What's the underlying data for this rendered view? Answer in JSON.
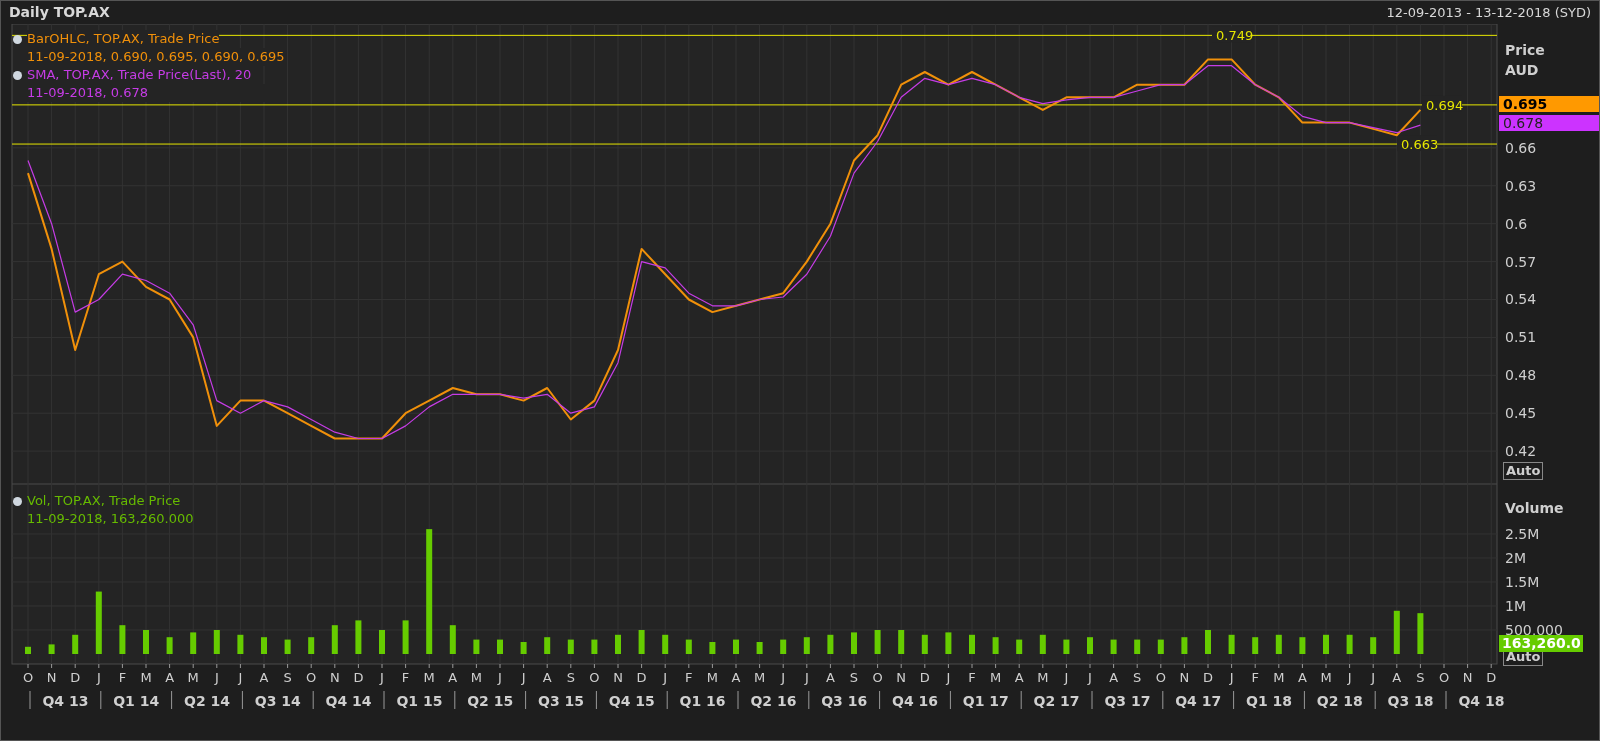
{
  "header": {
    "title": "Daily TOP.AX",
    "date_range": "12-09-2013 - 13-12-2018 (SYD)"
  },
  "price_panel": {
    "axis_title": "Price",
    "axis_unit": "AUD",
    "auto_button": "Auto",
    "legend": [
      {
        "title": "BarOHLC, TOP.AX, Trade Price",
        "reading": "11-09-2018, 0.690, 0.695, 0.690, 0.695",
        "color": "#f0900a"
      },
      {
        "title": "SMA, TOP.AX, Trade Price(Last),  20",
        "reading": "11-09-2018, 0.678",
        "color": "#c63ce6"
      }
    ],
    "badges": [
      {
        "label": "0.695",
        "color": "#ff9900"
      },
      {
        "label": "0.678",
        "color": "#cc33ff"
      }
    ],
    "chart_data": {
      "type": "line",
      "grid": true,
      "series": [
        {
          "color": "#f0900a",
          "values": [
            0.64,
            0.58,
            0.5,
            0.56,
            0.57,
            0.55,
            0.54,
            0.51,
            0.44,
            0.46,
            0.46,
            0.45,
            0.44,
            0.43,
            0.43,
            0.43,
            0.45,
            0.46,
            0.47,
            0.465,
            0.465,
            0.46,
            0.47,
            0.445,
            0.46,
            0.5,
            0.58,
            0.56,
            0.54,
            0.53,
            0.535,
            0.54,
            0.545,
            0.57,
            0.6,
            0.65,
            0.67,
            0.71,
            0.72,
            0.71,
            0.72,
            0.71,
            0.7,
            0.69,
            0.7,
            0.7,
            0.7,
            0.71,
            0.71,
            0.71,
            0.73,
            0.73,
            0.71,
            0.7,
            0.68,
            0.68,
            0.68,
            0.675,
            0.67,
            0.69,
            null,
            null,
            null
          ]
        },
        {
          "color": "#c63ce6",
          "values": [
            0.65,
            0.6,
            0.53,
            0.54,
            0.56,
            0.555,
            0.545,
            0.52,
            0.46,
            0.45,
            0.46,
            0.455,
            0.445,
            0.435,
            0.43,
            0.43,
            0.44,
            0.455,
            0.465,
            0.465,
            0.465,
            0.462,
            0.465,
            0.45,
            0.455,
            0.49,
            0.57,
            0.565,
            0.545,
            0.535,
            0.535,
            0.54,
            0.542,
            0.56,
            0.59,
            0.64,
            0.665,
            0.7,
            0.715,
            0.71,
            0.715,
            0.71,
            0.7,
            0.695,
            0.698,
            0.7,
            0.7,
            0.705,
            0.71,
            0.71,
            0.725,
            0.725,
            0.71,
            0.7,
            0.685,
            0.68,
            0.68,
            0.676,
            0.672,
            0.678,
            null,
            null,
            null
          ]
        }
      ],
      "ylim": [
        0.394,
        0.758
      ],
      "yticks": [
        0.42,
        0.45,
        0.48,
        0.51,
        0.54,
        0.57,
        0.6,
        0.63,
        0.66
      ],
      "ref_lines": [
        {
          "axis": "y",
          "value": 0.749,
          "label": "0.749"
        },
        {
          "axis": "y",
          "value": 0.694,
          "label": "0.694"
        },
        {
          "axis": "y",
          "value": 0.663,
          "label": "0.663"
        }
      ]
    }
  },
  "volume_panel": {
    "axis_title": "Volume",
    "auto_button": "Auto",
    "legend": {
      "title": "Vol, TOP.AX, Trade Price",
      "reading": "11-09-2018, 163,260.000",
      "color": "#66bb00"
    },
    "badge": {
      "label": "163,260.0",
      "color": "#66cc00"
    },
    "chart_data": {
      "type": "bar",
      "grid": true,
      "categories": [
        "O",
        "N",
        "D",
        "J",
        "F",
        "M",
        "A",
        "M",
        "J",
        "J",
        "A",
        "S",
        "O",
        "N",
        "D",
        "J",
        "F",
        "M",
        "A",
        "M",
        "J",
        "J",
        "A",
        "S",
        "O",
        "N",
        "D",
        "J",
        "F",
        "M",
        "A",
        "M",
        "J",
        "J",
        "A",
        "S",
        "O",
        "N",
        "D",
        "J",
        "F",
        "M",
        "A",
        "M",
        "J",
        "J",
        "A",
        "S",
        "O",
        "N",
        "D",
        "J",
        "F",
        "M",
        "A",
        "M",
        "J",
        "J",
        "A",
        "S",
        "O",
        "N",
        "D"
      ],
      "series": [
        {
          "color": "#66cc00",
          "values": [
            150000,
            200000,
            400000,
            1300000,
            600000,
            500000,
            350000,
            450000,
            500000,
            400000,
            350000,
            300000,
            350000,
            600000,
            700000,
            500000,
            700000,
            2600000,
            600000,
            300000,
            300000,
            250000,
            350000,
            300000,
            300000,
            400000,
            500000,
            400000,
            300000,
            250000,
            300000,
            250000,
            300000,
            350000,
            400000,
            450000,
            500000,
            500000,
            400000,
            450000,
            400000,
            350000,
            300000,
            400000,
            300000,
            350000,
            300000,
            300000,
            300000,
            350000,
            500000,
            400000,
            350000,
            400000,
            350000,
            400000,
            400000,
            350000,
            900000,
            850000,
            null,
            null,
            null
          ]
        }
      ],
      "ylim": [
        0,
        3540000
      ],
      "yticks": [
        {
          "value": 500000,
          "label": "500,000"
        },
        {
          "value": 1000000,
          "label": "1M"
        },
        {
          "value": 1500000,
          "label": "1.5M"
        },
        {
          "value": 2000000,
          "label": "2M"
        },
        {
          "value": 2500000,
          "label": "2.5M"
        }
      ]
    },
    "quarters": [
      "Q4 13",
      "Q1 14",
      "Q2 14",
      "Q3 14",
      "Q4 14",
      "Q1 15",
      "Q2 15",
      "Q3 15",
      "Q4 15",
      "Q1 16",
      "Q2 16",
      "Q3 16",
      "Q4 16",
      "Q1 17",
      "Q2 17",
      "Q3 17",
      "Q4 17",
      "Q1 18",
      "Q2 18",
      "Q3 18",
      "Q4 18"
    ]
  }
}
